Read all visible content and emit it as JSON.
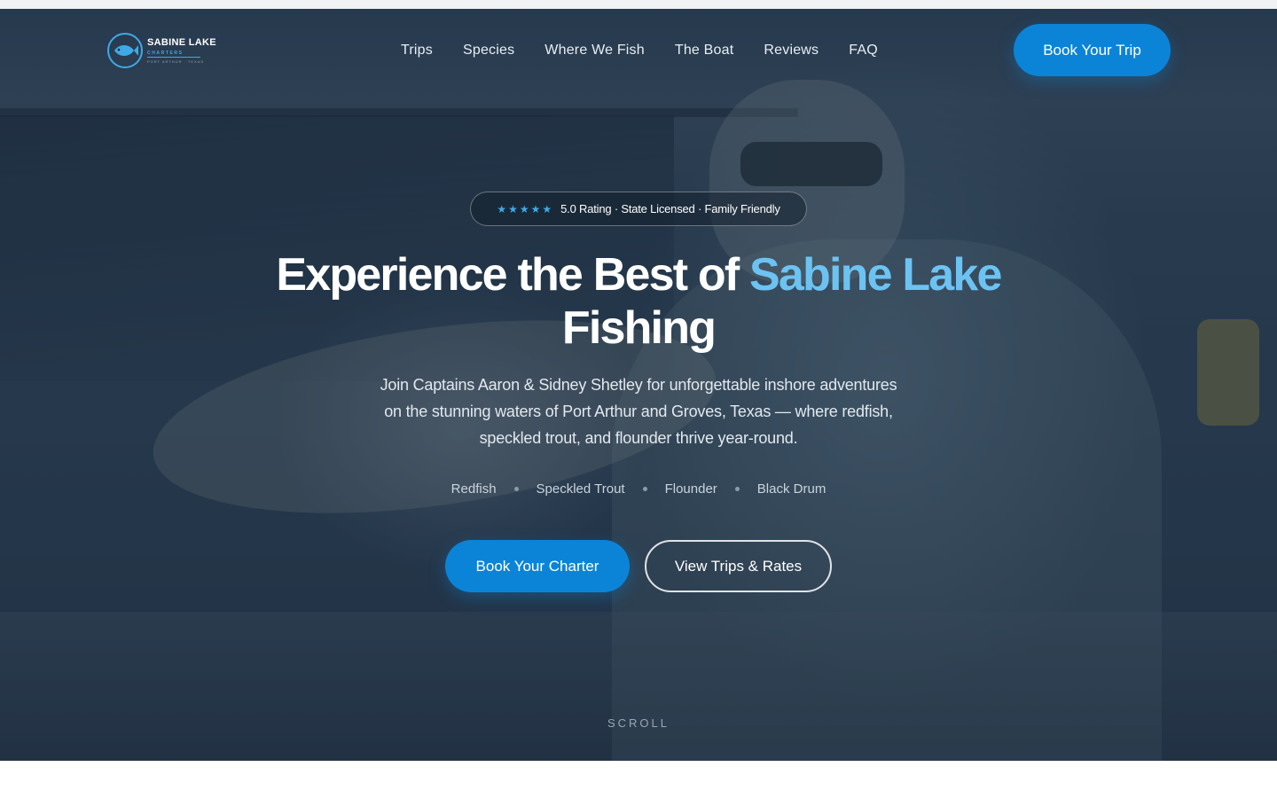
{
  "brand": {
    "title": "SABINE LAKE",
    "subtitle": "CHARTERS",
    "location": "PORT ARTHUR · TEXAS",
    "accent_color": "#3fa9e6"
  },
  "nav": {
    "items": [
      "Trips",
      "Species",
      "Where We Fish",
      "The Boat",
      "Reviews",
      "FAQ"
    ]
  },
  "header_cta": "Book Your Trip",
  "badge": {
    "stars": "★★★★★",
    "text": "5.0 Rating · State Licensed · Family Friendly"
  },
  "headline": {
    "part1": "Experience the Best of ",
    "accent": "Sabine Lake",
    "part2": "Fishing"
  },
  "subtext": "Join Captains Aaron & Sidney Shetley for unforgettable inshore adventures on the stunning waters of Port Arthur and Groves, Texas — where redfish, speckled trout, and flounder thrive year-round.",
  "species": [
    "Redfish",
    "Speckled Trout",
    "Flounder",
    "Black Drum"
  ],
  "ctas": {
    "primary": "Book Your Charter",
    "secondary": "View Trips & Rates"
  },
  "scroll_label": "SCROLL",
  "colors": {
    "primary_button": "#0b84d8",
    "headline_accent": "#6cc3f2"
  }
}
